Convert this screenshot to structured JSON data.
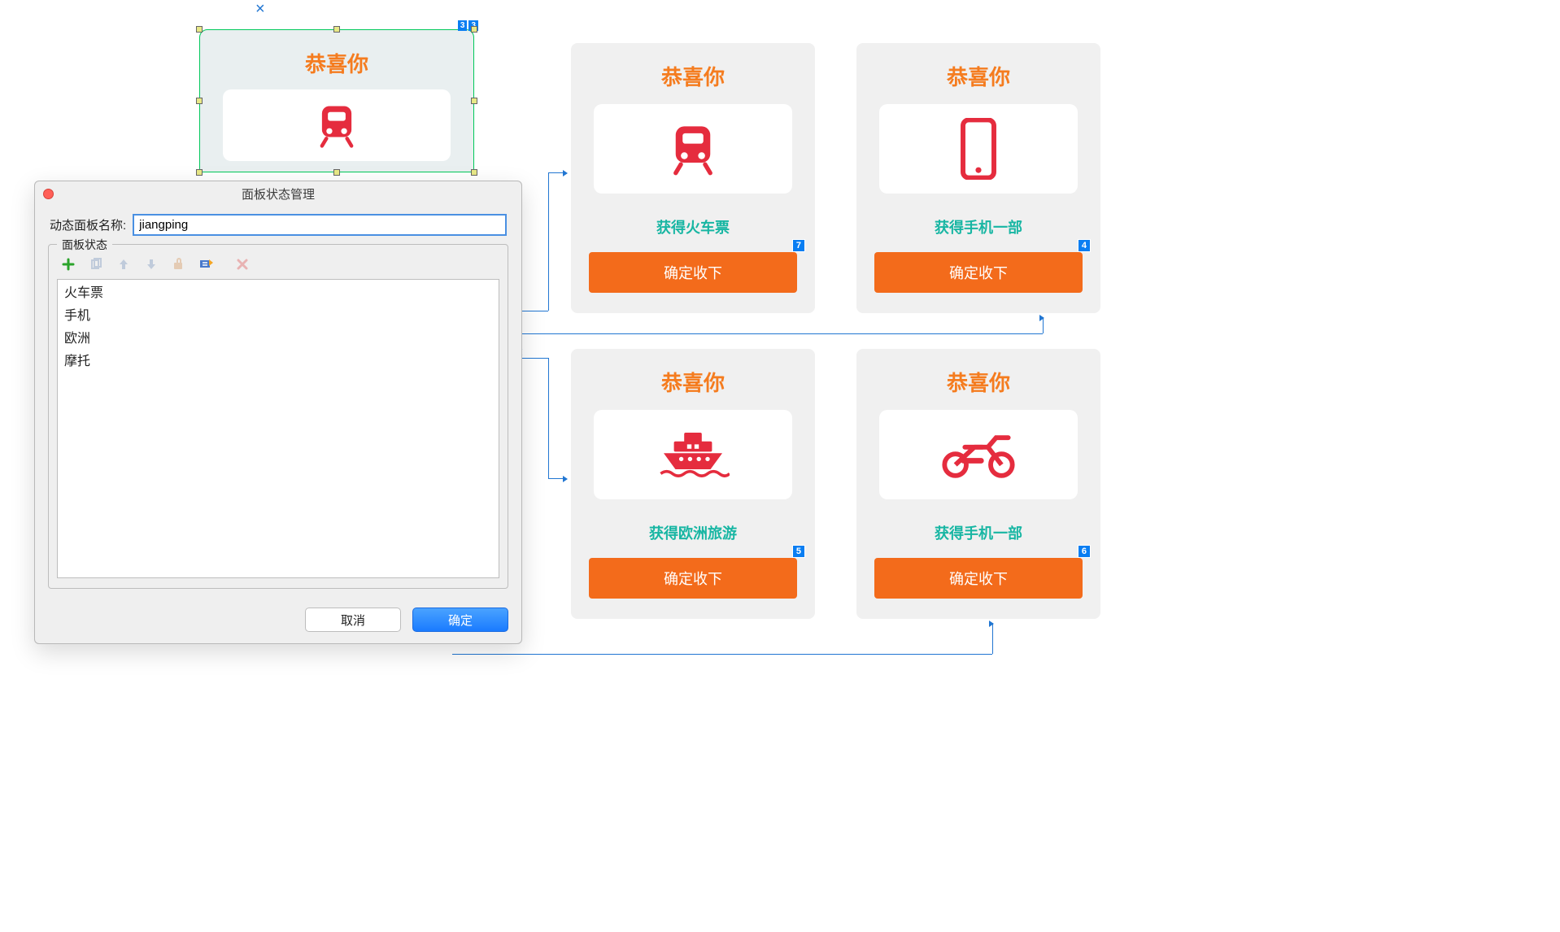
{
  "selected_panel": {
    "congrats": "恭喜你",
    "badge1": "3",
    "badge2": "3",
    "icon": "train-icon"
  },
  "cards": [
    {
      "congrats": "恭喜你",
      "prize": "获得火车票",
      "button": "确定收下",
      "badge": "7",
      "icon": "train-icon"
    },
    {
      "congrats": "恭喜你",
      "prize": "获得手机一部",
      "button": "确定收下",
      "badge": "4",
      "icon": "phone-icon"
    },
    {
      "congrats": "恭喜你",
      "prize": "获得欧洲旅游",
      "button": "确定收下",
      "badge": "5",
      "icon": "ship-icon"
    },
    {
      "congrats": "恭喜你",
      "prize": "获得手机一部",
      "button": "确定收下",
      "badge": "6",
      "icon": "motorcycle-icon"
    }
  ],
  "dialog": {
    "title": "面板状态管理",
    "name_label": "动态面板名称:",
    "name_value": "jiangping",
    "fieldset_label": "面板状态",
    "states": [
      "火车票",
      "手机",
      "欧洲",
      "摩托"
    ],
    "cancel": "取消",
    "ok": "确定"
  },
  "close_glyph": "×",
  "colors": {
    "accent": "#f57c1f",
    "teal": "#18b6a3",
    "orangeBtn": "#f36b1b",
    "iconRed": "#e52c3e",
    "link": "#2176d2"
  }
}
